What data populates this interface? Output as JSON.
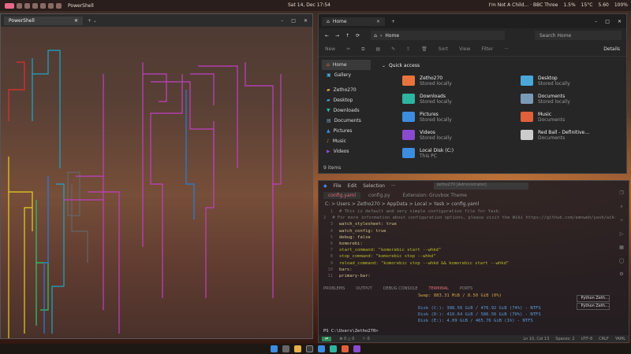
{
  "topbar": {
    "app_title": "PowerShell",
    "datetime": "Sat 14, Dec 17:54",
    "media": "I'm Not A Child… · BBC Three",
    "cpu": "1.5%",
    "temp": "15°C",
    "memory": "5.60",
    "battery": "100%"
  },
  "terminal": {
    "tab_label": "PowerShell",
    "new_tab": "+ ⌄",
    "win_min": "–",
    "win_max": "□",
    "win_close": "✕"
  },
  "explorer": {
    "tab_label": "Home",
    "new_tab": "+",
    "address": "Home",
    "search_placeholder": "Search Home",
    "toolbar": {
      "new": "New",
      "sort": "Sort",
      "view": "View",
      "filter": "Filter",
      "more": "···",
      "details": "Details"
    },
    "sidebar": [
      "Home",
      "Gallery",
      "Zetho270",
      "Desktop",
      "Downloads",
      "Documents",
      "Pictures",
      "Music",
      "Videos"
    ],
    "section_title": "Quick access",
    "quick_access": [
      {
        "name": "Zetho270",
        "sub": "Stored locally",
        "color": "#e8743c"
      },
      {
        "name": "Desktop",
        "sub": "Stored locally",
        "color": "#4aa8d8"
      },
      {
        "name": "Downloads",
        "sub": "Stored locally",
        "color": "#2eb4a0"
      },
      {
        "name": "Documents",
        "sub": "Stored locally",
        "color": "#7a9ab8"
      },
      {
        "name": "Pictures",
        "sub": "Stored locally",
        "color": "#3c8ce0"
      },
      {
        "name": "Music",
        "sub": "Documents",
        "color": "#e0603c"
      },
      {
        "name": "Videos",
        "sub": "Stored locally",
        "color": "#8a4ad0"
      },
      {
        "name": "Red Ball - Definitive…",
        "sub": "Documents",
        "color": "#cccccc"
      },
      {
        "name": "Local Disk (C:)",
        "sub": "This PC",
        "color": "#3c8ce0"
      }
    ],
    "status": "9 items"
  },
  "code": {
    "menu": [
      "File",
      "Edit",
      "Selection",
      "···"
    ],
    "search": "zetho270 [Administrator]",
    "tabs": [
      "config.yaml",
      "config.py",
      "Extension: Gruvbox Theme"
    ],
    "breadcrumb": "C: > Users > Zetho270 > AppData > Local > Yasb > config.yaml",
    "lines": [
      {
        "n": "1",
        "text": "# This is default and very simple configuration file for Yasb.",
        "color": "#7a7a7a"
      },
      {
        "n": "2",
        "text": "# For more information about configuration options, please visit the Wiki https://github.com/amnweb/yasb/wiki",
        "color": "#7a7a7a"
      },
      {
        "n": "3",
        "text": "watch_stylesheet: true",
        "color": "#d4c48a"
      },
      {
        "n": "4",
        "text": "watch_config: true",
        "color": "#d4c48a"
      },
      {
        "n": "5",
        "text": "debug: false",
        "color": "#d4c48a"
      },
      {
        "n": "6",
        "text": "komorebi:",
        "color": "#d4c48a"
      },
      {
        "n": "7",
        "text": "  start_command: \"komorebic start --whkd\"",
        "color": "#b8bb26"
      },
      {
        "n": "8",
        "text": "  stop_command: \"komorebic stop --whkd\"",
        "color": "#b8bb26"
      },
      {
        "n": "9",
        "text": "  reload_command: \"komorebic stop --whkd && komorebic start --whkd\"",
        "color": "#b8bb26"
      },
      {
        "n": "10",
        "text": "bars:",
        "color": "#d4c48a"
      },
      {
        "n": "11",
        "text": "  primary-bar:",
        "color": "#d4c48a"
      }
    ],
    "panel_tabs": [
      "PROBLEMS",
      "OUTPUT",
      "DEBUG CONSOLE",
      "TERMINAL",
      "PORTS"
    ],
    "terminal_lines": [
      "Swap: 883.31 MiB / 8.50 GiB (0%)",
      "",
      "Disk (C:): 388.56 GiB / 476.92 GiB (74%) - NTFS",
      "Disk (D:): 410.64 GiB / 586.56 GiB (70%) - NTFS",
      "Disk (E:): 4.09 GiB / 465.76 GiB (1%) - NTFS"
    ],
    "py_terminals": [
      "Python Zeth…",
      "Python Zeth…"
    ],
    "prompt": "PS C:\\Users\\Zetho270>",
    "status_left": [
      "⊗ 0 △ 0",
      "⚐ 0"
    ],
    "status_right": [
      "Ln 10, Col 13",
      "Spaces: 2",
      "UTF-8",
      "CRLF",
      "YAML"
    ]
  }
}
